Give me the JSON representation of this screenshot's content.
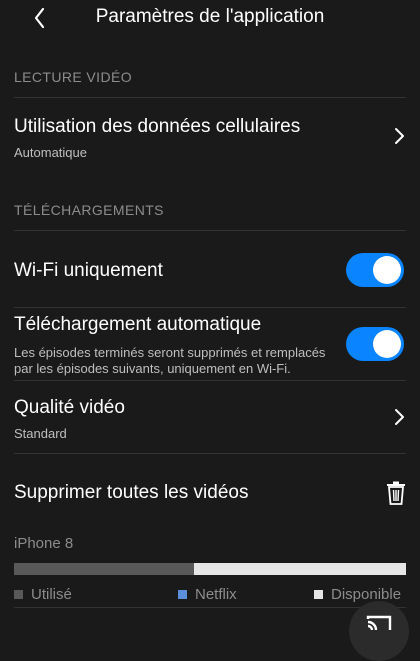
{
  "header": {
    "title": "Paramètres de l'application",
    "back_icon": "chevron-left-icon"
  },
  "sections": {
    "video_playback": "LECTURE VIDÉO",
    "downloads": "TÉLÉCHARGEMENTS"
  },
  "cellular": {
    "title": "Utilisation des données cellulaires",
    "value": "Automatique"
  },
  "wifi_only": {
    "title": "Wi-Fi uniquement",
    "on": true
  },
  "auto_download": {
    "title": "Téléchargement automatique",
    "desc_line1": "Les épisodes terminés seront supprimés et remplacés",
    "desc_line2": "par les épisodes suivants, uniquement en Wi-Fi.",
    "on": true
  },
  "video_quality": {
    "title": "Qualité vidéo",
    "value": "Standard"
  },
  "delete_all": {
    "title": "Supprimer toutes les vidéos",
    "icon": "trash-icon"
  },
  "storage": {
    "device": "iPhone 8",
    "used_fraction": 0.46,
    "legend_used": "Utilisé",
    "legend_netflix": "Netflix",
    "legend_available": "Disponible"
  },
  "colors": {
    "toggle_on": "#0a84ff",
    "used": "#595959",
    "netflix": "#5b8fd9",
    "available": "#e6e6e6",
    "background": "#1a1a1a"
  },
  "cast": {
    "icon": "cast-icon"
  }
}
